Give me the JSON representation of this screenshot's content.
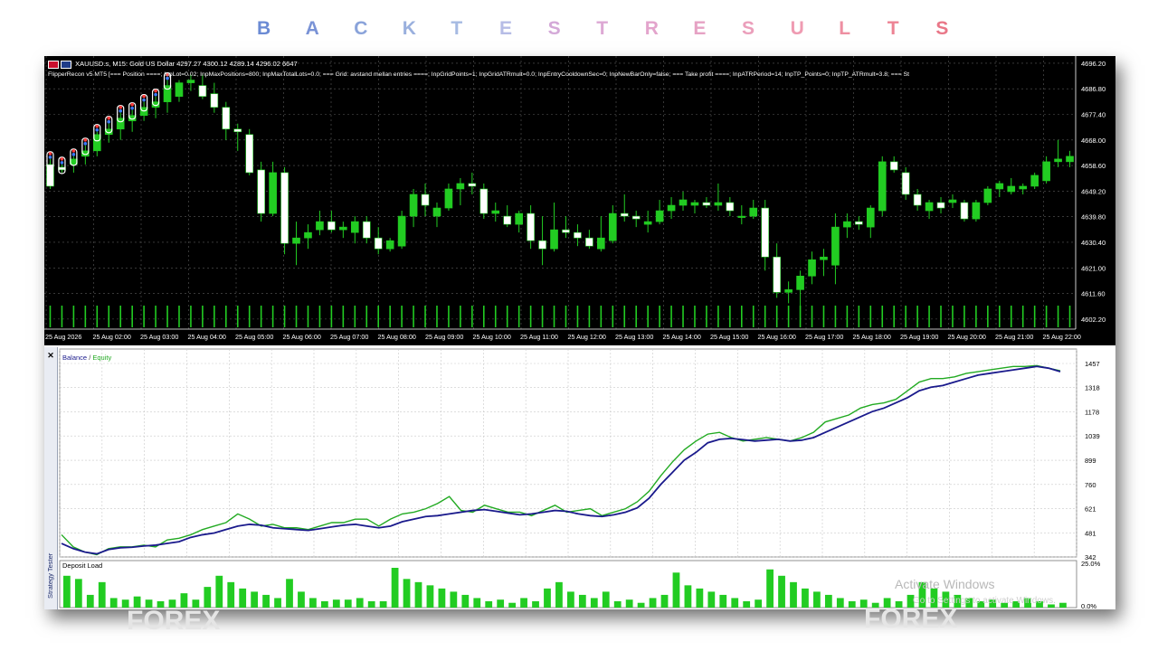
{
  "header": {
    "letters": [
      "B",
      "A",
      "C",
      "K",
      "T",
      "E",
      "S",
      "T",
      "R",
      "E",
      "S",
      "U",
      "L",
      "T",
      "S"
    ],
    "colors": [
      "#6b8bd4",
      "#7a93d6",
      "#8aa3da",
      "#9ab0de",
      "#a6bae2",
      "#b6bce6",
      "#d4a9d8",
      "#dda8d4",
      "#e3a4cc",
      "#e6a2c4",
      "#eb9fbb",
      "#ef9bb2",
      "#ee8fa2",
      "#ed8394",
      "#e97788"
    ]
  },
  "main_chart": {
    "symbol_line": "XAUUSD.s, M15:  Gold US Dollar  4297.27 4300.12 4289.14 4296.02  6647",
    "params_line": "FlipperRecon v5 MT5 [=== Position ====; InpLot=0.02; InpMaxPositions=800; InpMaxTotalLots=0.0; === Grid: avstand mellan entries ====; InpGridPoints=1; InpGridATRmult=0.0; InpEntryCooldownSec=0; InpNewBarOnly=false; === Take profit ====; InpATRPeriod=14; InpTP_Points=0; InpTP_ATRmult=3.8; === St",
    "price_labels": [
      "4696.20",
      "4686.80",
      "4677.40",
      "4668.00",
      "4658.60",
      "4649.20",
      "4639.80",
      "4630.40",
      "4621.00",
      "4611.60",
      "4602.20"
    ],
    "time_labels": [
      "25 Aug 2026",
      "25 Aug 02:00",
      "25 Aug 03:00",
      "25 Aug 04:00",
      "25 Aug 05:00",
      "25 Aug 06:00",
      "25 Aug 07:00",
      "25 Aug 08:00",
      "25 Aug 09:00",
      "25 Aug 10:00",
      "25 Aug 11:00",
      "25 Aug 12:00",
      "25 Aug 13:00",
      "25 Aug 14:00",
      "25 Aug 15:00",
      "25 Aug 16:00",
      "25 Aug 17:00",
      "25 Aug 18:00",
      "25 Aug 19:00",
      "25 Aug 20:00",
      "25 Aug 21:00",
      "25 Aug 22:00"
    ],
    "bull_color": "#22cc22",
    "bear_color": "#ffffff",
    "candles": [
      [
        4659,
        4661,
        4650,
        4651
      ],
      [
        4658,
        4659,
        4656,
        4657
      ],
      [
        4659,
        4662,
        4656,
        4661
      ],
      [
        4662,
        4666,
        4659,
        4664
      ],
      [
        4664,
        4671,
        4662,
        4670
      ],
      [
        4670,
        4674,
        4667,
        4672
      ],
      [
        4672,
        4678,
        4668,
        4676
      ],
      [
        4675,
        4679,
        4671,
        4677
      ],
      [
        4677,
        4682,
        4675,
        4680
      ],
      [
        4680,
        4684,
        4676,
        4682
      ],
      [
        4682,
        4690,
        4678,
        4688
      ],
      [
        4684,
        4690,
        4682,
        4689
      ],
      [
        4689,
        4692,
        4686,
        4690
      ],
      [
        4688,
        4692,
        4683,
        4684
      ],
      [
        4685,
        4689,
        4678,
        4680
      ],
      [
        4680,
        4682,
        4668,
        4672
      ],
      [
        4672,
        4674,
        4664,
        4671
      ],
      [
        4670,
        4672,
        4655,
        4656
      ],
      [
        4657,
        4660,
        4638,
        4641
      ],
      [
        4641,
        4660,
        4640,
        4656
      ],
      [
        4656,
        4658,
        4626,
        4630
      ],
      [
        4630,
        4638,
        4622,
        4632
      ],
      [
        4632,
        4637,
        4628,
        4634
      ],
      [
        4635,
        4642,
        4633,
        4638
      ],
      [
        4638,
        4642,
        4634,
        4635
      ],
      [
        4635,
        4638,
        4632,
        4636
      ],
      [
        4634,
        4640,
        4630,
        4638
      ],
      [
        4638,
        4640,
        4630,
        4632
      ],
      [
        4632,
        4636,
        4626,
        4628
      ],
      [
        4628,
        4632,
        4627,
        4631
      ],
      [
        4629,
        4642,
        4628,
        4640
      ],
      [
        4640,
        4650,
        4636,
        4648
      ],
      [
        4648,
        4652,
        4640,
        4644
      ],
      [
        4640,
        4645,
        4636,
        4643
      ],
      [
        4643,
        4652,
        4642,
        4650
      ],
      [
        4650,
        4654,
        4644,
        4652
      ],
      [
        4652,
        4656,
        4648,
        4651
      ],
      [
        4650,
        4652,
        4639,
        4641
      ],
      [
        4641,
        4645,
        4638,
        4642
      ],
      [
        4640,
        4644,
        4636,
        4637
      ],
      [
        4637,
        4642,
        4634,
        4641
      ],
      [
        4641,
        4644,
        4628,
        4631
      ],
      [
        4631,
        4640,
        4622,
        4628
      ],
      [
        4628,
        4645,
        4627,
        4635
      ],
      [
        4635,
        4640,
        4632,
        4634
      ],
      [
        4634,
        4637,
        4629,
        4632
      ],
      [
        4632,
        4635,
        4628,
        4629
      ],
      [
        4628,
        4640,
        4627,
        4632
      ],
      [
        4631,
        4644,
        4630,
        4641
      ],
      [
        4641,
        4648,
        4638,
        4640
      ],
      [
        4640,
        4642,
        4636,
        4639
      ],
      [
        4637,
        4642,
        4634,
        4638
      ],
      [
        4638,
        4646,
        4637,
        4642
      ],
      [
        4642,
        4647,
        4639,
        4644
      ],
      [
        4644,
        4649,
        4642,
        4646
      ],
      [
        4644,
        4646,
        4641,
        4645
      ],
      [
        4645,
        4647,
        4643,
        4644
      ],
      [
        4644,
        4652,
        4642,
        4645
      ],
      [
        4645,
        4647,
        4640,
        4642
      ],
      [
        4640,
        4644,
        4637,
        4640
      ],
      [
        4640,
        4646,
        4639,
        4643
      ],
      [
        4643,
        4646,
        4620,
        4625
      ],
      [
        4625,
        4630,
        4610,
        4612
      ],
      [
        4612,
        4616,
        4608,
        4613
      ],
      [
        4613,
        4620,
        4606,
        4618
      ],
      [
        4618,
        4627,
        4615,
        4624
      ],
      [
        4624,
        4628,
        4618,
        4625
      ],
      [
        4622,
        4641,
        4615,
        4636
      ],
      [
        4636,
        4641,
        4632,
        4638
      ],
      [
        4638,
        4640,
        4635,
        4637
      ],
      [
        4636,
        4644,
        4632,
        4643
      ],
      [
        4642,
        4662,
        4640,
        4660
      ],
      [
        4660,
        4662,
        4656,
        4657
      ],
      [
        4656,
        4658,
        4646,
        4648
      ],
      [
        4648,
        4650,
        4642,
        4644
      ],
      [
        4642,
        4646,
        4639,
        4645
      ],
      [
        4645,
        4647,
        4641,
        4643
      ],
      [
        4645,
        4648,
        4643,
        4646
      ],
      [
        4645,
        4646,
        4638,
        4639
      ],
      [
        4639,
        4646,
        4638,
        4645
      ],
      [
        4645,
        4651,
        4644,
        4650
      ],
      [
        4650,
        4653,
        4647,
        4652
      ],
      [
        4649,
        4654,
        4648,
        4651
      ],
      [
        4650,
        4652,
        4648,
        4651
      ],
      [
        4651,
        4656,
        4650,
        4655
      ],
      [
        4653,
        4662,
        4652,
        4660
      ],
      [
        4660,
        4668,
        4658,
        4661
      ],
      [
        4660,
        4664,
        4658,
        4662
      ]
    ]
  },
  "tester": {
    "legend_balance": "Balance",
    "legend_sep": " / ",
    "legend_equity": "Equity",
    "balance_color": "#1a1a8c",
    "equity_color": "#22aa22",
    "y_labels": [
      "1457",
      "1318",
      "1178",
      "1039",
      "899",
      "760",
      "621",
      "481",
      "342"
    ],
    "y_min": 342,
    "y_max": 1457,
    "balance": [
      420,
      390,
      370,
      360,
      385,
      395,
      398,
      405,
      410,
      420,
      430,
      455,
      470,
      480,
      500,
      520,
      530,
      525,
      510,
      505,
      500,
      495,
      505,
      515,
      525,
      530,
      520,
      510,
      520,
      545,
      560,
      575,
      580,
      590,
      600,
      610,
      615,
      605,
      595,
      585,
      590,
      600,
      610,
      605,
      590,
      580,
      575,
      585,
      600,
      625,
      680,
      760,
      830,
      900,
      945,
      1000,
      1020,
      1025,
      1018,
      1010,
      1015,
      1020,
      1010,
      1015,
      1030,
      1060,
      1090,
      1120,
      1150,
      1180,
      1200,
      1230,
      1260,
      1300,
      1320,
      1330,
      1350,
      1370,
      1390,
      1400,
      1410,
      1420,
      1430,
      1440,
      1430,
      1410
    ],
    "equity": [
      470,
      400,
      370,
      355,
      390,
      400,
      400,
      410,
      400,
      440,
      450,
      470,
      500,
      520,
      540,
      590,
      560,
      520,
      530,
      510,
      510,
      500,
      520,
      540,
      540,
      560,
      560,
      520,
      560,
      590,
      600,
      620,
      650,
      690,
      610,
      600,
      640,
      620,
      600,
      600,
      580,
      610,
      640,
      600,
      610,
      620,
      580,
      600,
      620,
      660,
      720,
      810,
      890,
      960,
      1010,
      1050,
      1060,
      1030,
      1010,
      1020,
      1030,
      1020,
      1010,
      1030,
      1060,
      1120,
      1140,
      1160,
      1200,
      1220,
      1230,
      1250,
      1300,
      1350,
      1370,
      1370,
      1380,
      1400,
      1410,
      1420,
      1430,
      1440,
      1440,
      1445,
      1430,
      1415
    ],
    "deposit_load_label": "Deposit Load",
    "deposit_max_label": "25.0%",
    "deposit_min_label": "0.0%",
    "deposit_load": [
      20,
      18,
      8,
      16,
      6,
      5,
      7,
      5,
      4,
      5,
      9,
      5,
      13,
      20,
      16,
      12,
      10,
      8,
      6,
      18,
      10,
      6,
      4,
      5,
      5,
      6,
      4,
      4,
      25,
      18,
      16,
      14,
      12,
      10,
      8,
      6,
      4,
      5,
      3,
      6,
      4,
      12,
      16,
      10,
      8,
      6,
      10,
      4,
      5,
      3,
      6,
      8,
      22,
      14,
      12,
      10,
      8,
      6,
      4,
      5,
      24,
      20,
      16,
      12,
      10,
      8,
      6,
      4,
      5,
      3,
      6,
      4,
      8,
      16,
      12,
      10,
      8,
      6,
      4,
      5,
      3,
      4,
      6,
      4,
      2,
      3
    ],
    "deposit_color": "#22cc22",
    "side_tab": "Strategy Tester",
    "close_glyph": "✕"
  },
  "overlays": {
    "activate_windows": "Activate Windows",
    "activate_sub": "Go to Settings to activate Windows.",
    "ghost_left": "FOREX",
    "ghost_right": "FOREX"
  }
}
